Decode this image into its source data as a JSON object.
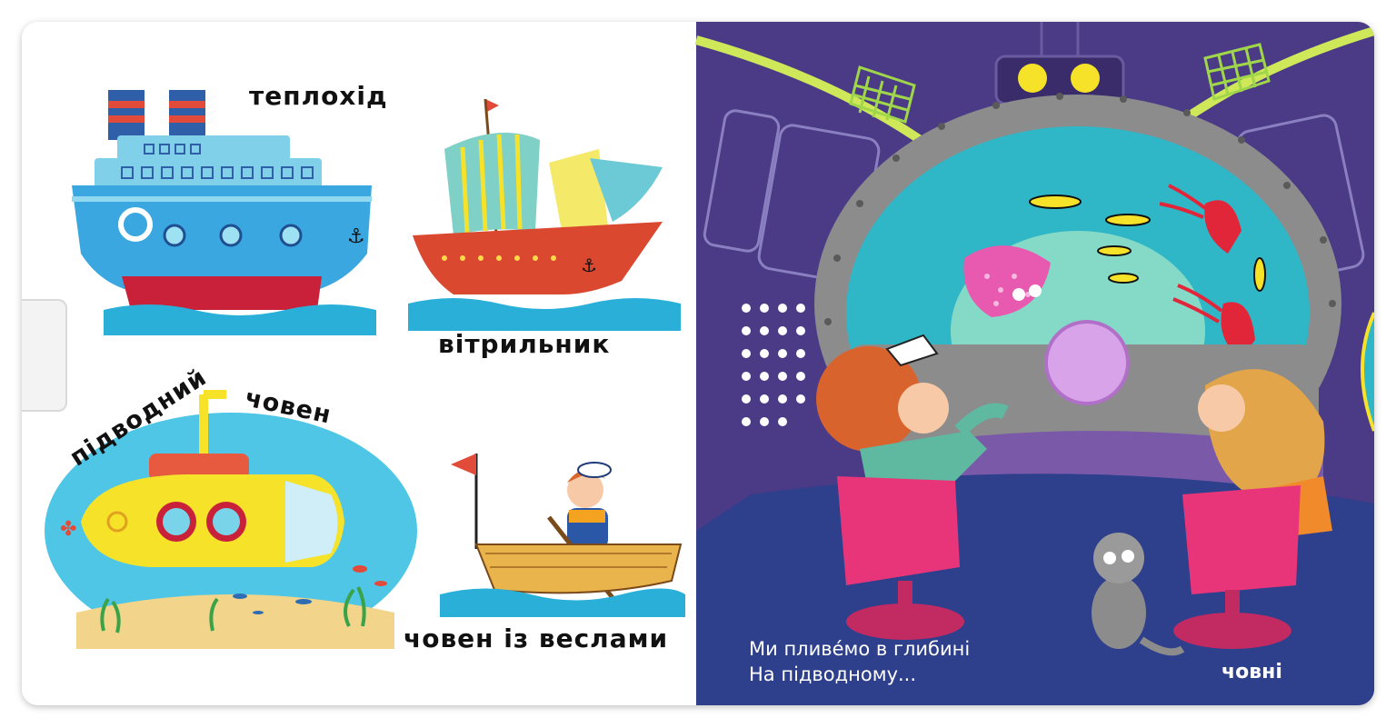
{
  "left_page": {
    "labels": {
      "motor_ship": "теплохід",
      "sailboat": "вітрильник",
      "submarine_word1": "підводний",
      "submarine_word2": "човен",
      "rowboat": "човен із веслами"
    }
  },
  "right_page": {
    "caption_line1": "Ми пливе́мо в глибині",
    "caption_line2": "На підводному...",
    "answer": "човні"
  },
  "colors": {
    "right_bg": "#4b3a86",
    "porthole_frame": "#8c8c8c",
    "water": "#2fb7c7",
    "chair": "#e8357a",
    "ship_hull": "#3aa7e0",
    "submarine_body": "#f5e229"
  },
  "icons": [
    "anchor-icon",
    "life-ring-icon",
    "flag-icon",
    "periscope-icon",
    "propeller-icon",
    "fish-icon",
    "squid-icon"
  ]
}
